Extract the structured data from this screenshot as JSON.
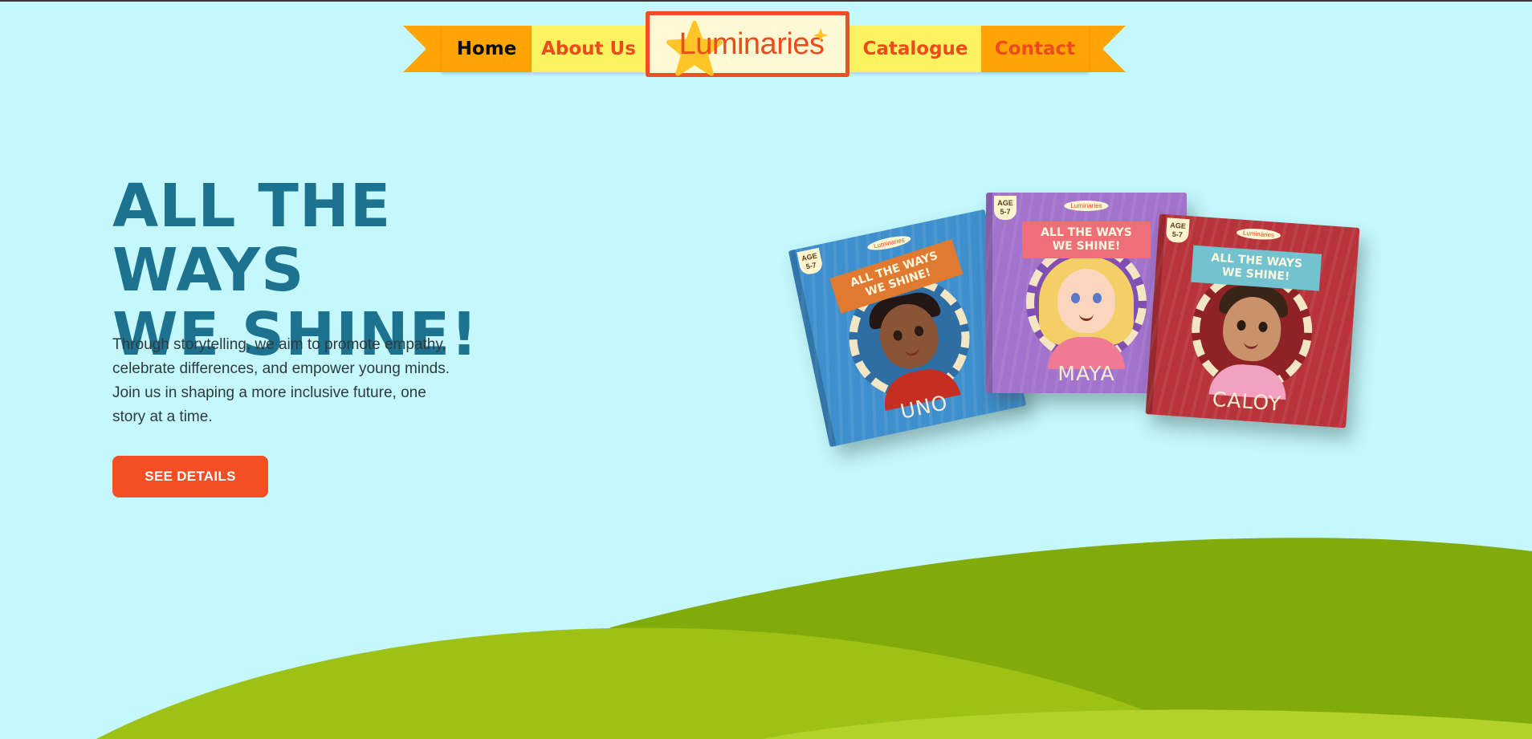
{
  "nav": {
    "items": [
      {
        "label": "Home",
        "active": true
      },
      {
        "label": "About Us",
        "active": false
      },
      {
        "label": "Catalogue",
        "active": false
      },
      {
        "label": "Contact",
        "active": false
      }
    ],
    "logo_text": "Luminaries"
  },
  "hero": {
    "title_line1": "ALL THE WAYS",
    "title_line2": "WE SHINE!",
    "description": "Through storytelling, we aim to promote empathy, celebrate differences, and empower young minds. Join us in shaping a more inclusive future, one story at a time.",
    "cta_label": "SEE DETAILS"
  },
  "books": [
    {
      "title_line1": "ALL THE WAYS",
      "title_line2": "WE SHINE!",
      "name": "UNO",
      "age_label": "AGE",
      "age": "5-7",
      "logo": "Luminaries"
    },
    {
      "title_line1": "ALL THE WAYS",
      "title_line2": "WE SHINE!",
      "name": "MAYA",
      "age_label": "AGE",
      "age": "5-7",
      "logo": "Luminaries"
    },
    {
      "title_line1": "ALL THE WAYS",
      "title_line2": "WE SHINE!",
      "name": "CALOY",
      "age_label": "AGE",
      "age": "5-7",
      "logo": "Luminaries"
    }
  ],
  "colors": {
    "background": "#c4f8fc",
    "accent": "#f44e25",
    "ribbon_orange": "#ffa405",
    "ribbon_yellow": "#fdf361",
    "title": "#1d728f",
    "hill_dark": "#80ab0b",
    "hill_light": "#a5c91a"
  }
}
